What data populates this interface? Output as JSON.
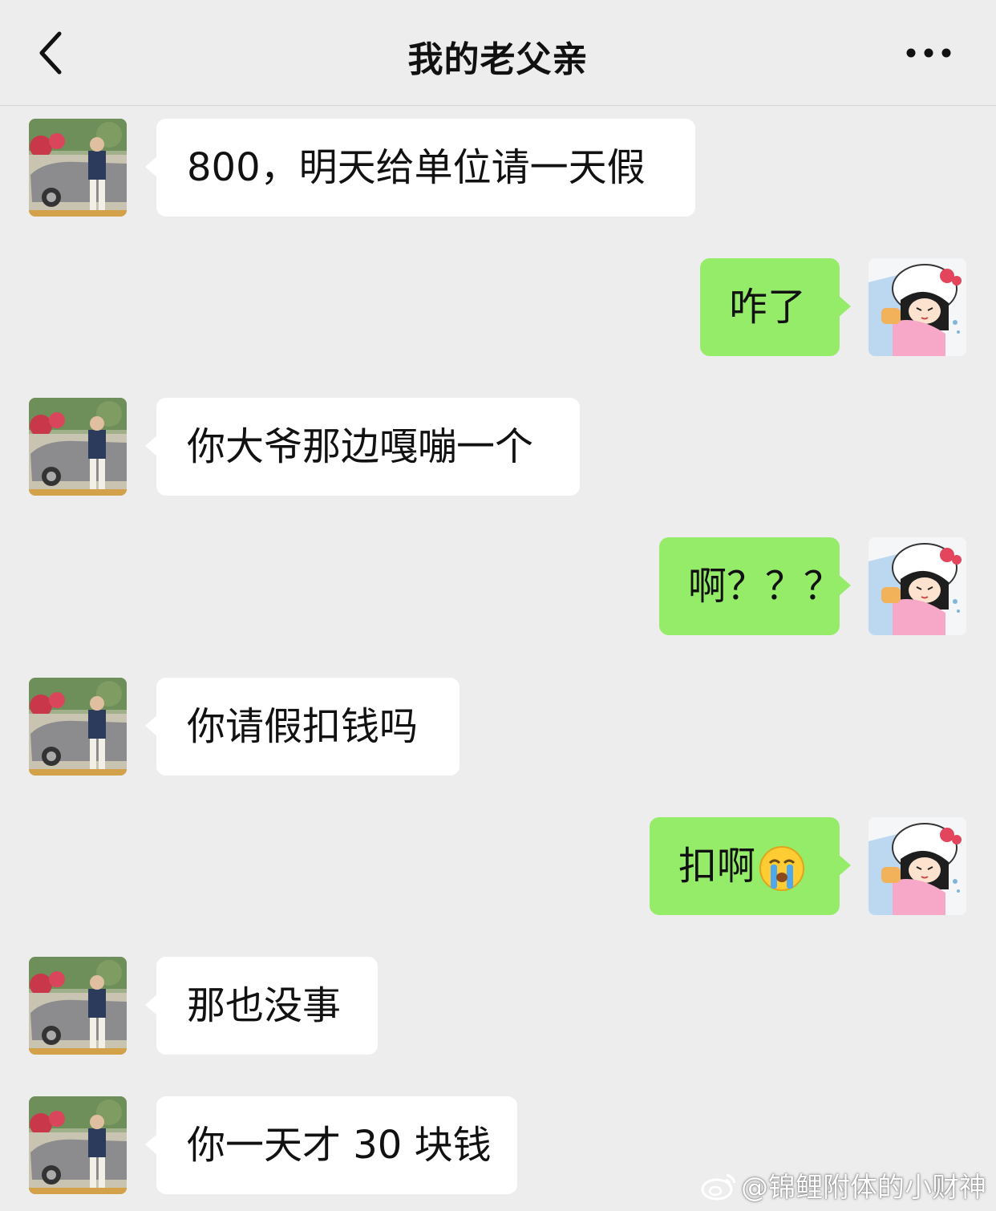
{
  "header": {
    "title": "我的老父亲",
    "back_icon": "chevron-left-icon",
    "more_icon": "more-dots-icon"
  },
  "messages": [
    {
      "side": "left",
      "text": "800，明天给单位请一天假"
    },
    {
      "side": "right",
      "text": "咋了"
    },
    {
      "side": "left",
      "text": "你大爷那边嘎嘣一个"
    },
    {
      "side": "right",
      "text": "啊？？？"
    },
    {
      "side": "left",
      "text": "你请假扣钱吗"
    },
    {
      "side": "right",
      "text": "扣啊",
      "emoji": "crying-face-icon"
    },
    {
      "side": "left",
      "text": "那也没事"
    },
    {
      "side": "left",
      "text": "你一天才 30 块钱"
    }
  ],
  "watermark": {
    "text": "@锦鲤附体的小财神",
    "icon": "weibo-logo-icon"
  },
  "colors": {
    "background": "#ededed",
    "bubble_self": "#95ec69",
    "bubble_other": "#ffffff"
  }
}
